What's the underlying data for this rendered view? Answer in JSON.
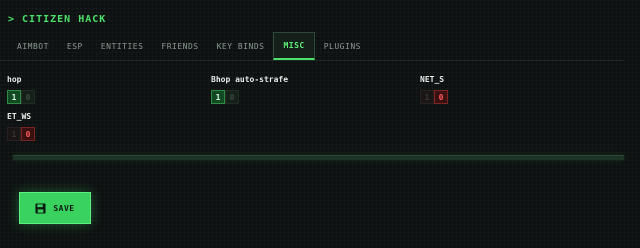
{
  "app": {
    "title": "> CITIZEN HACK"
  },
  "tabs": [
    {
      "label": "AIMBOT"
    },
    {
      "label": "ESP"
    },
    {
      "label": "ENTITIES"
    },
    {
      "label": "FRIENDS"
    },
    {
      "label": "KEY BINDS"
    },
    {
      "label": "MISC",
      "active": true
    },
    {
      "label": "PLUGINS"
    }
  ],
  "fields": [
    {
      "label": "hop",
      "on": "1",
      "off": "0",
      "value": "1"
    },
    {
      "label": "Bhop auto-strafe",
      "on": "1",
      "off": "0",
      "value": "1"
    },
    {
      "label": "NET_S",
      "on": "1",
      "off": "0",
      "value": "0"
    },
    {
      "label": "ET_WS",
      "on": "1",
      "off": "0",
      "value": "0"
    }
  ],
  "save": {
    "label": "SAVE",
    "icon": "floppy-disk-icon"
  },
  "colors": {
    "accent": "#4ce06a",
    "danger": "#ff5b5b",
    "background": "#0d1111"
  }
}
